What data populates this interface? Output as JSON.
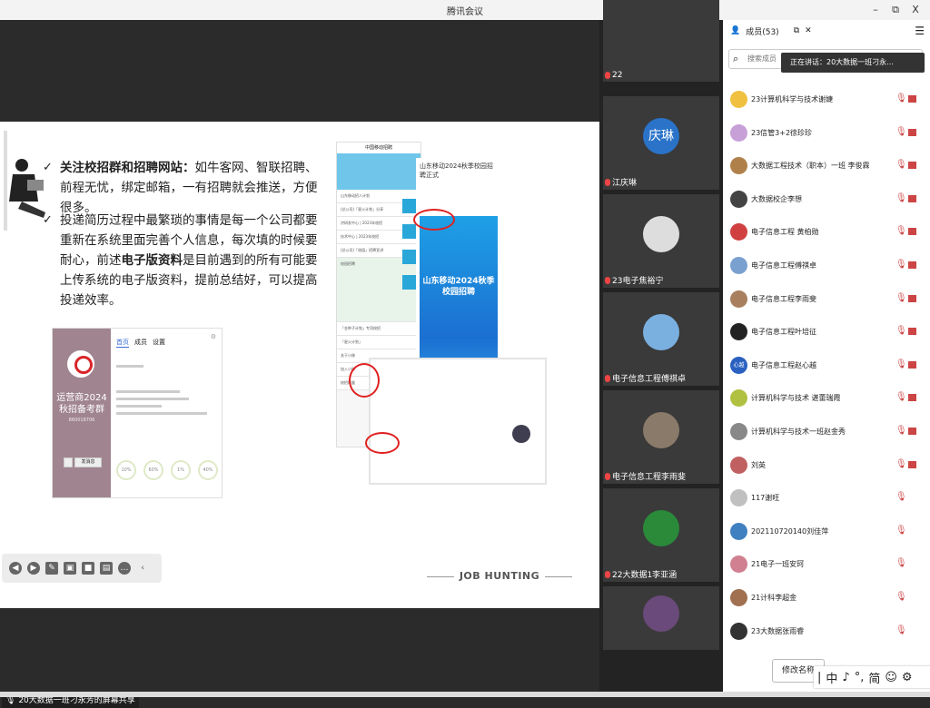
{
  "window": {
    "title": "腾讯会议",
    "min": "–",
    "restore": "⧉",
    "close": "X"
  },
  "slide": {
    "bullet1": {
      "bold": "关注校招群和招聘网站：",
      "text": "如牛客网、智联招聘、前程无忧，绑定邮箱，一有招聘就会推送，方便很多。"
    },
    "bullet2": {
      "pre": "投递简历过程中最繁琐的事情是每一个公司都要重新在系统里面完善个人信息，每次填的时候要耐心，前述",
      "bold": "电子版资料",
      "post": "是目前遇到的所有可能要上传系统的电子版资料，提前总结好，可以提高投递效率。"
    },
    "check": "✓",
    "job_hunting": "JOB HUNTING",
    "shot1": {
      "left_text": "运营商2024秋招备考群",
      "left_small": "860018706",
      "tabs": [
        "首页",
        "成员",
        "设置"
      ],
      "btn": "发消息",
      "circles": [
        "10%",
        "60%",
        "1%",
        "40%"
      ]
    },
    "shot2": {
      "header": "中国移动招聘",
      "rows": [
        "山东移动招人计划",
        "(总公司)「星火计划」分享",
        "洪研发中心 | 2023年校招",
        "技术中心 | 2023年校招",
        "(总公司)「校园」招聘宣讲",
        "校园招聘",
        "「金种子计划」专项校招",
        "「星火计划」",
        "关于小移",
        "加入小移",
        "校招移盒"
      ]
    },
    "shot3": {
      "title": "山东移动2024秋季校园招聘正式",
      "poster": "山东移动2024秋季校园招聘"
    }
  },
  "share_label": "20大数据一班刁永芳的屏幕共享",
  "videos": [
    {
      "label": "22"
    },
    {
      "label": "江庆琳",
      "avatar_text": "庆琳"
    },
    {
      "label": "23电子焦裕宁"
    },
    {
      "label": "电子信息工程傅祺卓"
    },
    {
      "label": "电子信息工程李雨斐"
    },
    {
      "label": "22大数据1李亚涵"
    },
    {
      "label": ""
    }
  ],
  "panel": {
    "members_tab": "成员(53)",
    "search_placeholder": "搜索成员",
    "speaking": "正在讲话：20大数据一班刁永...",
    "footer_btn": "修改名称",
    "members": [
      {
        "name": "23计算机科学与技术谢婕",
        "color": "#f0c040"
      },
      {
        "name": "23信管3+2徐珍珍",
        "color": "#c8a0d8"
      },
      {
        "name": "大数据工程技术（职本）一班 李俊霖",
        "color": "#b0804a"
      },
      {
        "name": "大数据校企李想",
        "color": "#444"
      },
      {
        "name": "电子信息工程 黄柏勋",
        "color": "#d04040"
      },
      {
        "name": "电子信息工程傅祺卓",
        "color": "#7aa0d0"
      },
      {
        "name": "电子信息工程李雨斐",
        "color": "#a88060"
      },
      {
        "name": "电子信息工程叶培征",
        "color": "#222"
      },
      {
        "name": "电子信息工程赵心越",
        "color": "#2a60c0",
        "text": "心越"
      },
      {
        "name": "计算机科学与技术 谌蕾瑞霞",
        "color": "#b0c040"
      },
      {
        "name": "计算机科学与技术一班赵金秀",
        "color": "#888"
      },
      {
        "name": "刘英",
        "color": "#c06060"
      },
      {
        "name": "117谢旺",
        "color": "#c0c0c0"
      },
      {
        "name": "202110720140刘佳萍",
        "color": "#4080c0"
      },
      {
        "name": "21电子一班安珂",
        "color": "#d08090"
      },
      {
        "name": "21计科李超金",
        "color": "#a07050"
      },
      {
        "name": "23大数据张雨睿",
        "color": "#333"
      }
    ]
  },
  "ime": [
    "|",
    "中",
    "♪",
    "°,",
    "简",
    "☺",
    "⚙"
  ]
}
